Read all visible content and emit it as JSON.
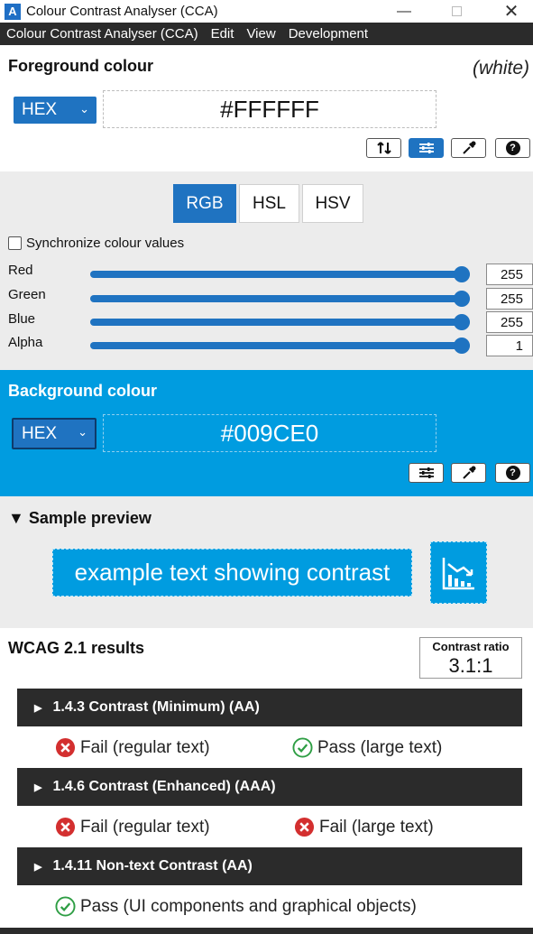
{
  "window": {
    "title": "Colour Contrast Analyser (CCA)",
    "app_icon": "A",
    "minimize": "—",
    "close": "✕"
  },
  "menu": [
    "Colour Contrast Analyser (CCA)",
    "Edit",
    "View",
    "Development"
  ],
  "foreground": {
    "title": "Foreground colour",
    "name": "(white)",
    "format": "HEX",
    "hex": "#FFFFFF",
    "tools": [
      "swap-icon",
      "sliders-icon",
      "eyedropper-icon",
      "help-icon"
    ]
  },
  "sliders": {
    "tabs": [
      "RGB",
      "HSL",
      "HSV"
    ],
    "active_tab": "RGB",
    "sync_label": "Synchronize colour values",
    "sync_checked": false,
    "channels": [
      {
        "label": "Red",
        "value": "255",
        "level": 1.0
      },
      {
        "label": "Green",
        "value": "255",
        "level": 1.0
      },
      {
        "label": "Blue",
        "value": "255",
        "level": 1.0
      },
      {
        "label": "Alpha",
        "value": "1",
        "level": 1.0
      }
    ]
  },
  "background": {
    "title": "Background colour",
    "format": "HEX",
    "hex": "#009CE0",
    "color": "#009ce0"
  },
  "preview": {
    "title": "Sample preview",
    "sample_text": "example text showing contrast",
    "icon": "chart-icon"
  },
  "results": {
    "title": "WCAG 2.1 results",
    "ratio_label": "Contrast ratio",
    "ratio_value": "3.1:1",
    "criteria": [
      {
        "label": "1.4.3 Contrast (Minimum) (AA)",
        "verdicts": [
          {
            "status": "fail",
            "text": "Fail (regular text)"
          },
          {
            "status": "pass",
            "text": "Pass (large text)"
          }
        ]
      },
      {
        "label": "1.4.6 Contrast (Enhanced) (AAA)",
        "verdicts": [
          {
            "status": "fail",
            "text": "Fail (regular text)"
          },
          {
            "status": "fail",
            "text": "Fail (large text)"
          }
        ]
      },
      {
        "label": "1.4.11 Non-text Contrast (AA)",
        "verdicts": [
          {
            "status": "pass",
            "text": "Pass (UI components and graphical objects)"
          }
        ]
      }
    ]
  },
  "colors": {
    "accent": "#1f73c1",
    "background_sample": "#009ce0",
    "fail": "#d32f2f",
    "pass": "#2e9e44",
    "dark_bar": "#2b2b2b"
  }
}
